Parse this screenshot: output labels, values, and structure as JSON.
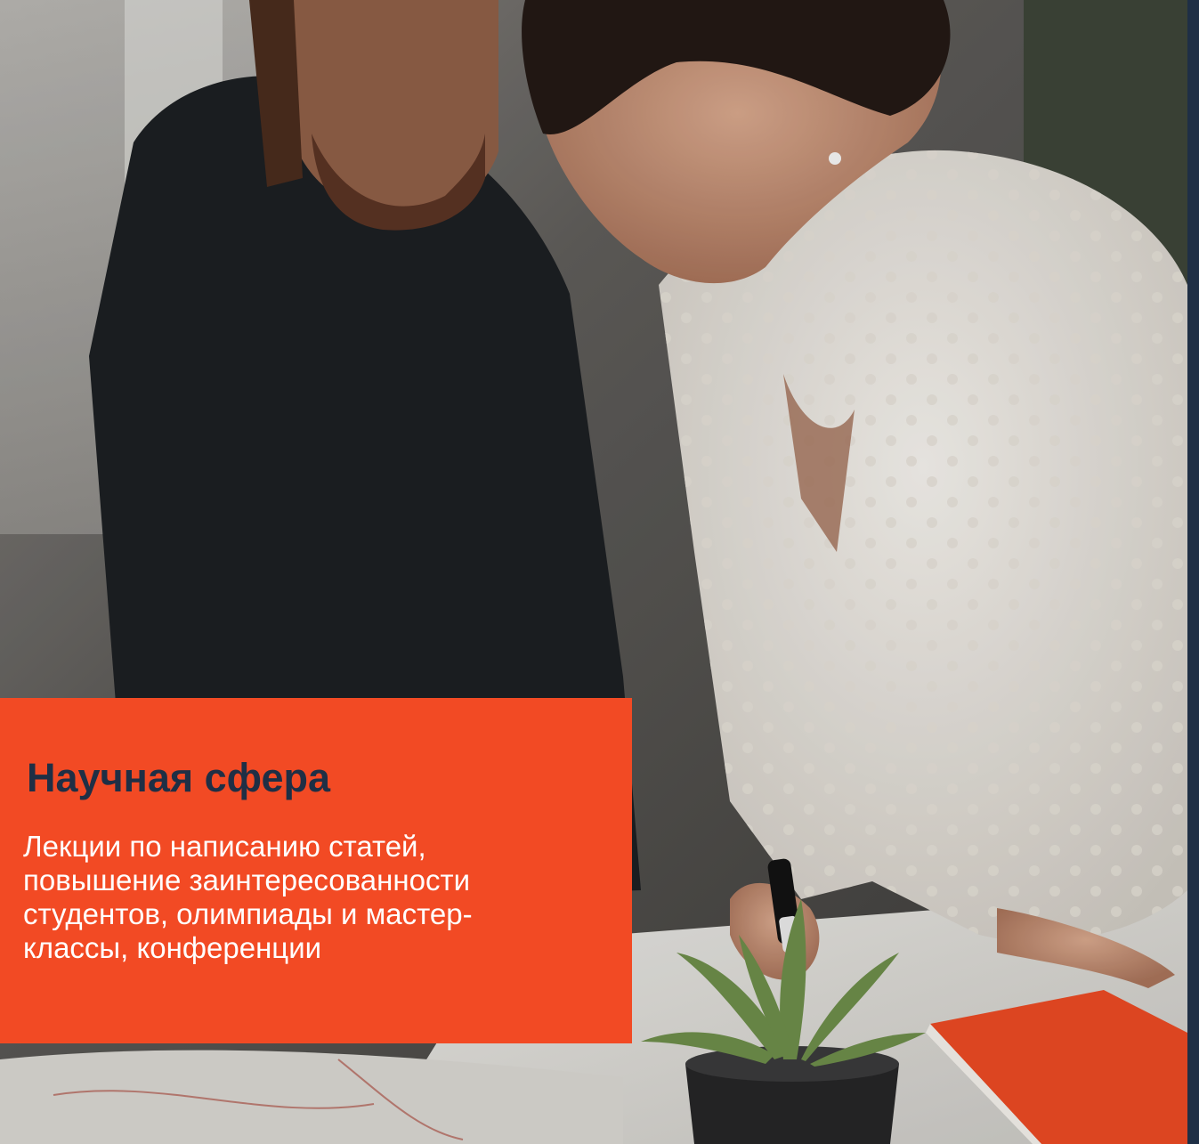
{
  "card": {
    "title": "Научная сфера",
    "description": "Лекции по написанию статей, повышение заинтересованности студентов, олимпиады и мастер-классы, конференции"
  },
  "colors": {
    "card_background": "#f24a24",
    "title_color": "#1f2f45",
    "text_color": "#ffffff",
    "edge_strip": "#1f2f45"
  },
  "photo": {
    "subject": "man-and-woman-working-at-table",
    "objects": [
      "man-dark-sweater",
      "woman-white-polka-dot-blouse",
      "marker",
      "potted-succulent",
      "orange-notebook",
      "paper-sheet"
    ]
  }
}
